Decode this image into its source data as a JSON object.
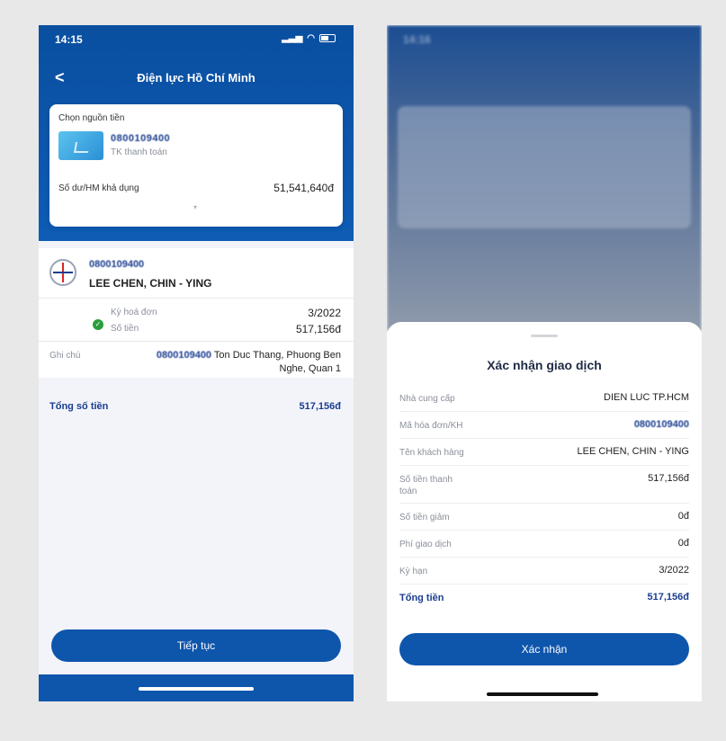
{
  "left": {
    "status": {
      "time": "14:15"
    },
    "nav": {
      "back": "<",
      "title": "Điện lực Hồ Chí Minh"
    },
    "source": {
      "label": "Chọn nguồn tiền",
      "account_number": "0800109400",
      "account_type": "TK thanh toán",
      "balance_label": "Số dư/HM khả dụng",
      "balance_value": "51,541,640đ"
    },
    "customer": {
      "code": "0800109400",
      "name": "LEE CHEN, CHIN - YING"
    },
    "bill": {
      "period_label": "Kỳ hoá đơn",
      "period_value": "3/2022",
      "amount_label": "Số tiền",
      "amount_value": "517,156đ"
    },
    "note": {
      "label": "Ghi chú",
      "code": "0800109400",
      "address": "Ton Duc Thang, Phuong Ben Nghe, Quan 1"
    },
    "total": {
      "label": "Tổng số tiền",
      "value": "517,156đ"
    },
    "continue_label": "Tiếp tục"
  },
  "right": {
    "status": {
      "time": "14:16"
    },
    "sheet": {
      "title": "Xác nhận giao dịch",
      "rows": [
        {
          "label": "Nhà cung cấp",
          "value": "DIEN LUC TP.HCM"
        },
        {
          "label": "Mã hóa đơn/KH",
          "value": "0800109400"
        },
        {
          "label": "Tên khách hàng",
          "value": "LEE CHEN, CHIN - YING"
        },
        {
          "label": "Số tiền thanh toán",
          "value": "517,156đ"
        },
        {
          "label": "Số tiền giảm",
          "value": "0đ"
        },
        {
          "label": "Phí giao dịch",
          "value": "0đ"
        },
        {
          "label": "Kỳ hạn",
          "value": "3/2022"
        },
        {
          "label": "Tổng tiền",
          "value": "517,156đ"
        }
      ],
      "confirm_label": "Xác nhận"
    }
  }
}
